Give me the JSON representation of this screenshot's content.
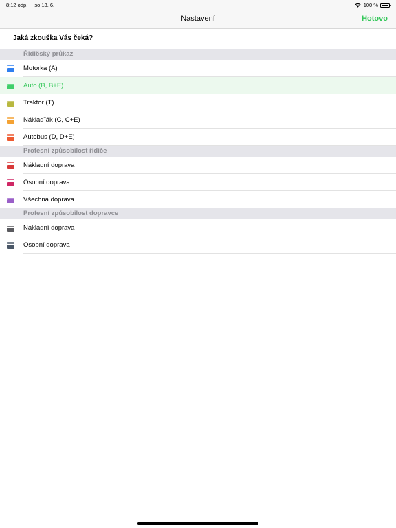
{
  "status_bar": {
    "time": "8:12 odp.",
    "date": "so 13. 6.",
    "battery_text": "100 %"
  },
  "navbar": {
    "title": "Nastavení",
    "done_label": "Hotovo",
    "accent_color": "#34c759"
  },
  "question": "Jaká zkouška Vás čeká?",
  "sections": [
    {
      "title": "Řidičský průkaz",
      "items": [
        {
          "label": "Motorka (A)",
          "color": "#2f7ff0",
          "icon": "book-icon",
          "selected": false
        },
        {
          "label": "Auto (B, B+E)",
          "color": "#3fcf6a",
          "icon": "book-icon",
          "selected": true
        },
        {
          "label": "Traktor (T)",
          "color": "#b8b840",
          "icon": "book-icon",
          "selected": false
        },
        {
          "label": "Nákladˇák (C, C+E)",
          "color": "#f4a233",
          "icon": "book-icon",
          "selected": false
        },
        {
          "label": "Autobus (D, D+E)",
          "color": "#ee5a30",
          "icon": "book-icon",
          "selected": false
        }
      ]
    },
    {
      "title": "Profesní způsobilost řidiče",
      "items": [
        {
          "label": "Nákladní doprava",
          "color": "#d83a3a",
          "icon": "book-icon",
          "selected": false
        },
        {
          "label": "Osobní doprava",
          "color": "#cf2765",
          "icon": "book-icon",
          "selected": false
        },
        {
          "label": "Všechna doprava",
          "color": "#9a5fc8",
          "icon": "book-icon",
          "selected": false
        }
      ]
    },
    {
      "title": "Profesní způsobilost dopravce",
      "items": [
        {
          "label": "Nákladní doprava",
          "color": "#5a5a5e",
          "icon": "book-icon",
          "selected": false
        },
        {
          "label": "Osobní doprava",
          "color": "#4b5868",
          "icon": "book-icon",
          "selected": false
        }
      ]
    }
  ]
}
